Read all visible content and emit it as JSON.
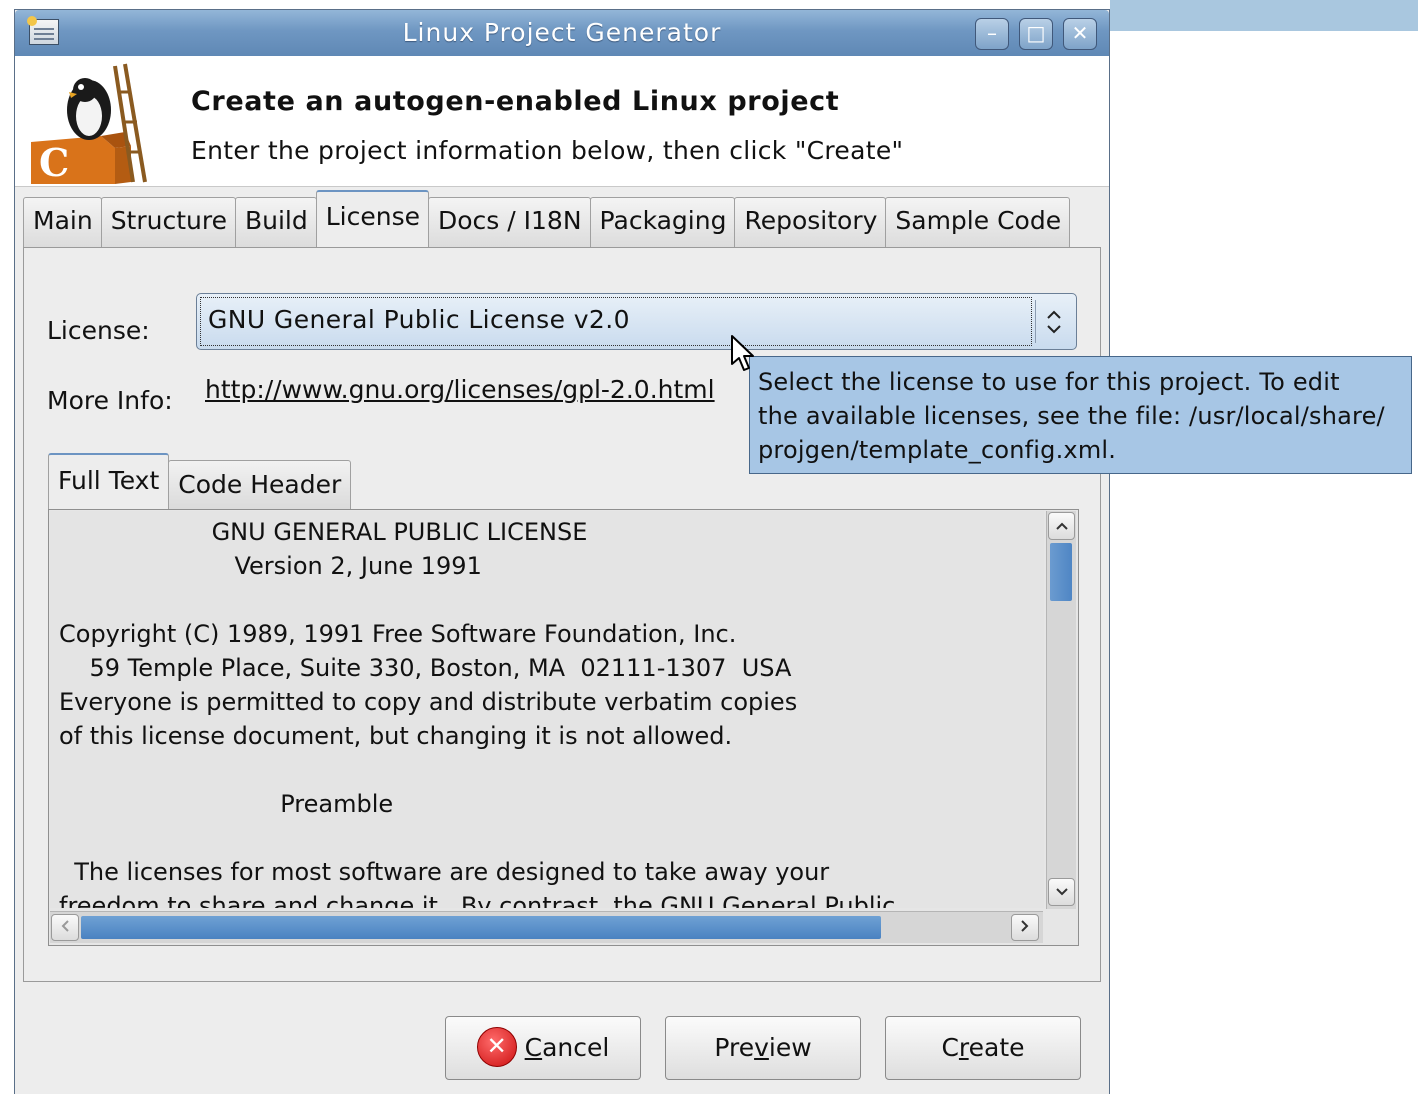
{
  "window": {
    "title": "Linux Project Generator",
    "controls": {
      "minimize": "–",
      "maximize": "□",
      "close": "✕"
    }
  },
  "header": {
    "title": "Create an autogen-enabled Linux project",
    "subtitle": "Enter the project information below, then click \"Create\"",
    "logo_letter": "C"
  },
  "tabs": [
    {
      "label": "Main",
      "active": false
    },
    {
      "label": "Structure",
      "active": false
    },
    {
      "label": "Build",
      "active": false
    },
    {
      "label": "License",
      "active": true
    },
    {
      "label": "Docs / I18N",
      "active": false
    },
    {
      "label": "Packaging",
      "active": false
    },
    {
      "label": "Repository",
      "active": false
    },
    {
      "label": "Sample Code",
      "active": false
    }
  ],
  "license": {
    "label": "License:",
    "selected": "GNU General Public License v2.0",
    "more_info_label": "More Info:",
    "more_info_url": "http://www.gnu.org/licenses/gpl-2.0.html"
  },
  "inner_tabs": [
    {
      "label": "Full Text",
      "active": true
    },
    {
      "label": "Code Header",
      "active": false
    }
  ],
  "full_text": "                    GNU GENERAL PUBLIC LICENSE\n                       Version 2, June 1991\n\nCopyright (C) 1989, 1991 Free Software Foundation, Inc.\n    59 Temple Place, Suite 330, Boston, MA  02111-1307  USA\nEveryone is permitted to copy and distribute verbatim copies\nof this license document, but changing it is not allowed.\n\n                             Preamble\n\n  The licenses for most software are designed to take away your\nfreedom to share and change it.  By contrast, the GNU General Public",
  "tooltip": {
    "lines": [
      "Select the license to use for this project. To edit",
      "the available licenses, see the file: /usr/local/share/",
      "projgen/template_config.xml."
    ]
  },
  "buttons": {
    "cancel": {
      "pre": "",
      "mnemonic": "C",
      "post": "ancel"
    },
    "preview": {
      "pre": "Pre",
      "mnemonic": "v",
      "post": "iew"
    },
    "create": {
      "pre": "C",
      "mnemonic": "r",
      "post": "eate"
    }
  },
  "icons": {
    "app": "app-icon",
    "cancel": "cancel-x-icon",
    "scroll_up": "▲",
    "scroll_down": "▼",
    "scroll_left": "<",
    "scroll_right": ">",
    "combo_arrows": "up-down-arrows"
  },
  "colors": {
    "titlebar": "#6f97c2",
    "tooltip_bg": "#a7c6e5",
    "scroll_thumb": "#4f86c4"
  }
}
